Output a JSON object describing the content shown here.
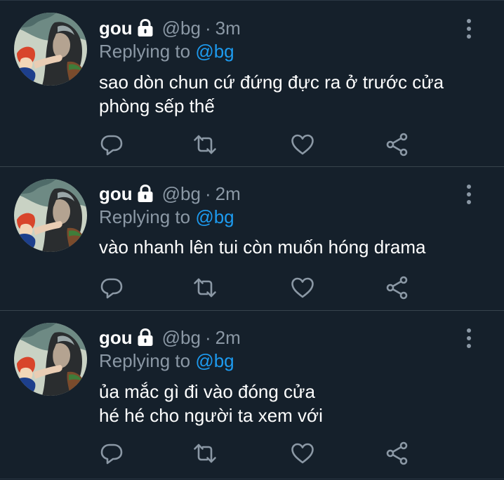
{
  "colors": {
    "background": "#15202b",
    "divider": "#38444d",
    "text_primary": "#ffffff",
    "text_secondary": "#8b98a5",
    "mention": "#1d9bf0"
  },
  "icons": {
    "protected": "lock-icon",
    "more": "more-vertical-icon",
    "reply": "reply-icon",
    "retweet": "retweet-icon",
    "like": "heart-icon",
    "share": "share-icon"
  },
  "tweets": [
    {
      "name": "gou",
      "handle": "@bg",
      "separator": "·",
      "time": "3m",
      "replying_prefix": "Replying to",
      "replying_to": "@bg",
      "lines": [
        "sao dòn chun cứ đứng đực ra ở trước cửa",
        "phòng sếp thế"
      ]
    },
    {
      "name": "gou",
      "handle": "@bg",
      "separator": "·",
      "time": "2m",
      "replying_prefix": "Replying to",
      "replying_to": "@bg",
      "lines": [
        "vào nhanh lên tui còn muốn hóng drama"
      ]
    },
    {
      "name": "gou",
      "handle": "@bg",
      "separator": "·",
      "time": "2m",
      "replying_prefix": "Replying to",
      "replying_to": "@bg",
      "lines": [
        "ủa mắc gì đi vào đóng cửa",
        "hé hé cho người ta xem với"
      ]
    }
  ]
}
